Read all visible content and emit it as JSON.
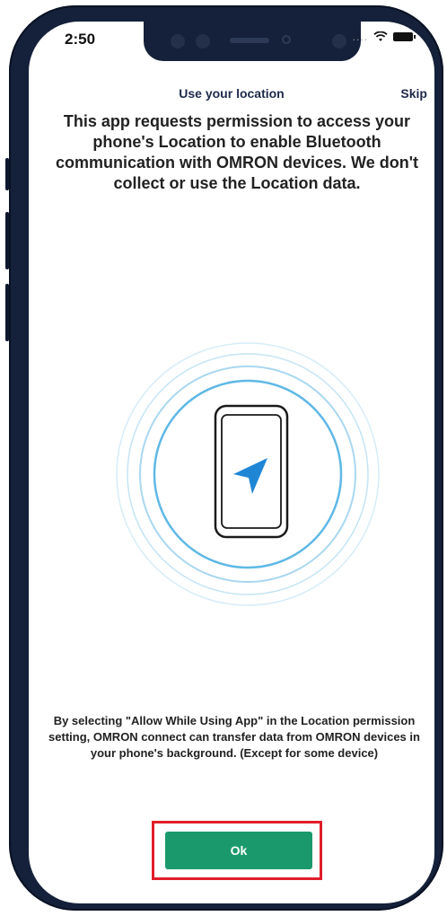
{
  "status_bar": {
    "time": "2:50",
    "signal": "....",
    "wifi_icon": "wifi-icon",
    "battery_icon": "battery-icon"
  },
  "header": {
    "title": "Use your location",
    "skip_label": "Skip"
  },
  "main": {
    "message": "This app requests permission to access your phone's Location to enable Bluetooth communication with OMRON devices. We don't collect or use the Location data.",
    "illustration_icon": "phone-location-icon",
    "footer_message": "By selecting \"Allow While Using App\" in the Location permission setting, OMRON connect can transfer data from OMRON devices in your phone's background. (Except for some device)"
  },
  "actions": {
    "ok_label": "Ok"
  },
  "colors": {
    "accent": "#1a9a6c",
    "ring": "#5fb8e6",
    "arrow": "#1f86d6",
    "highlight": "#e01e2a"
  }
}
